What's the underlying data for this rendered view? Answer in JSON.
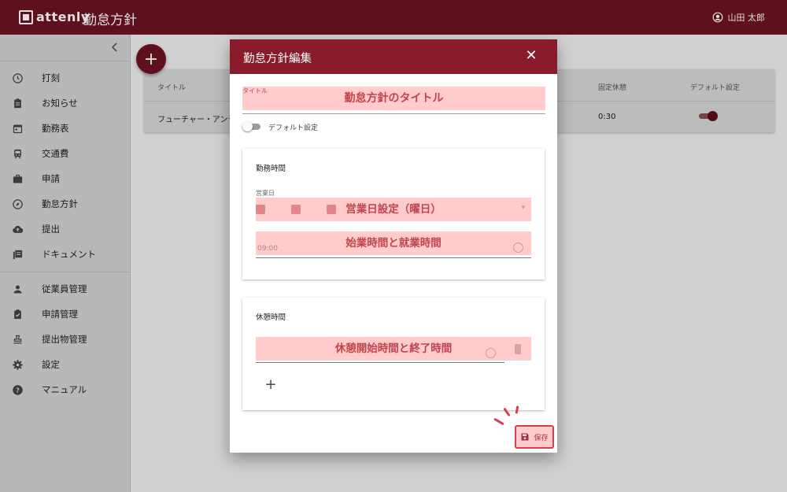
{
  "app": {
    "logo_text": "attenly",
    "title": "勤怠方針",
    "user": "山田 太郎"
  },
  "sidebar": {
    "items": [
      {
        "label": "打刻",
        "icon": "clock-icon"
      },
      {
        "label": "お知らせ",
        "icon": "clipboard-icon"
      },
      {
        "label": "勤務表",
        "icon": "calendar-icon"
      },
      {
        "label": "交通費",
        "icon": "train-icon"
      },
      {
        "label": "申請",
        "icon": "briefcase-icon"
      },
      {
        "label": "勤怠方針",
        "icon": "compass-icon"
      },
      {
        "label": "提出",
        "icon": "cloud-upload-icon"
      },
      {
        "label": "ドキュメント",
        "icon": "library-icon"
      }
    ],
    "admin_items": [
      {
        "label": "従業員管理",
        "icon": "person-icon"
      },
      {
        "label": "申請管理",
        "icon": "clipboard-check-icon"
      },
      {
        "label": "提出物管理",
        "icon": "stamp-icon"
      },
      {
        "label": "設定",
        "icon": "gear-icon"
      },
      {
        "label": "マニュアル",
        "icon": "help-icon"
      }
    ]
  },
  "fab": {
    "label": "+"
  },
  "table": {
    "headers": {
      "title": "タイトル",
      "fixed_break": "固定休憩",
      "default": "デフォルト設定"
    },
    "row": {
      "title": "フューチャー・アンテ",
      "fixed_break": "0:30",
      "default_on": true
    }
  },
  "dialog": {
    "title": "勤怠方針編集",
    "close": "✕",
    "title_field": {
      "label": "タイトル",
      "value": "勤怠方針のタイトル"
    },
    "default_toggle": {
      "label": "デフォルト設定",
      "on": false
    },
    "work_card": {
      "title": "勤務時間",
      "workday_label": "営業日",
      "workday_value": "営業日設定（曜日）",
      "time_value": "始業時間と就業時間",
      "start_time": "09:00"
    },
    "break_card": {
      "title": "休憩時間",
      "value": "休憩開始時間と終了時間",
      "add": "+"
    },
    "save": {
      "label": "保存"
    }
  },
  "colors": {
    "appbar": "#6b1420",
    "dialog_header": "#8a1b2a",
    "highlight": "#ffa0a0",
    "accent": "#d0414d"
  }
}
